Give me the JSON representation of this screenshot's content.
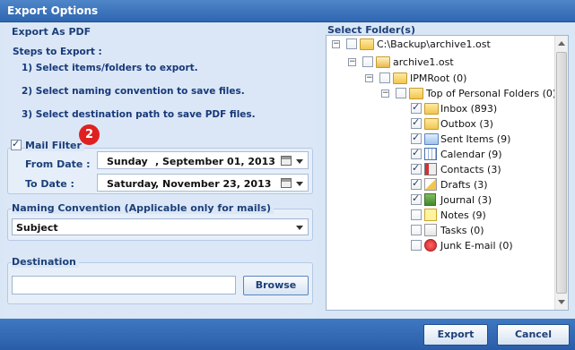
{
  "window": {
    "title": "Export Options"
  },
  "left": {
    "export_title": "Export As PDF",
    "steps_title": "Steps to Export :",
    "steps": [
      "1) Select items/folders to export.",
      "2) Select naming convention to save files.",
      "3) Select destination path to save PDF files."
    ],
    "mail_filter": {
      "label": "Mail Filter",
      "checked": true,
      "badge": "2",
      "from_label": "From Date :",
      "from_day": "Sunday",
      "from_date": ", September 01, 2013",
      "to_label": "To Date :",
      "to_day": "Saturday",
      "to_date": ", November 23, 2013"
    },
    "naming": {
      "title": "Naming Convention (Applicable only for mails)",
      "selected": "Subject"
    },
    "destination": {
      "title": "Destination",
      "value": "",
      "browse": "Browse"
    }
  },
  "right": {
    "title": "Select Folder(s)",
    "tree": [
      {
        "label": "C:\\Backup\\archive1.ost",
        "checked": false,
        "icon": "folder-open-icon"
      },
      {
        "label": "archive1.ost",
        "checked": false,
        "icon": "pst-file-icon"
      },
      {
        "label": "IPMRoot (0)",
        "checked": false,
        "icon": "folder-icon"
      },
      {
        "label": "Top of Personal Folders (0)",
        "checked": false,
        "icon": "folder-icon"
      },
      {
        "label": "Inbox (893)",
        "checked": true,
        "icon": "inbox-icon"
      },
      {
        "label": "Outbox (3)",
        "checked": true,
        "icon": "outbox-icon"
      },
      {
        "label": "Sent Items (9)",
        "checked": true,
        "icon": "sent-items-icon"
      },
      {
        "label": "Calendar (9)",
        "checked": true,
        "icon": "calendar-icon"
      },
      {
        "label": "Contacts (3)",
        "checked": true,
        "icon": "contacts-icon"
      },
      {
        "label": "Drafts (3)",
        "checked": true,
        "icon": "drafts-icon"
      },
      {
        "label": "Journal (3)",
        "checked": true,
        "icon": "journal-icon"
      },
      {
        "label": "Notes (9)",
        "checked": false,
        "icon": "notes-icon"
      },
      {
        "label": "Tasks (0)",
        "checked": false,
        "icon": "tasks-icon"
      },
      {
        "label": "Junk E-mail (0)",
        "checked": false,
        "icon": "junk-email-icon"
      }
    ]
  },
  "footer": {
    "export": "Export",
    "cancel": "Cancel"
  },
  "colors": {
    "titlebar": "#2e66b0",
    "panel": "#dbe7f6",
    "badge": "#e02020"
  }
}
